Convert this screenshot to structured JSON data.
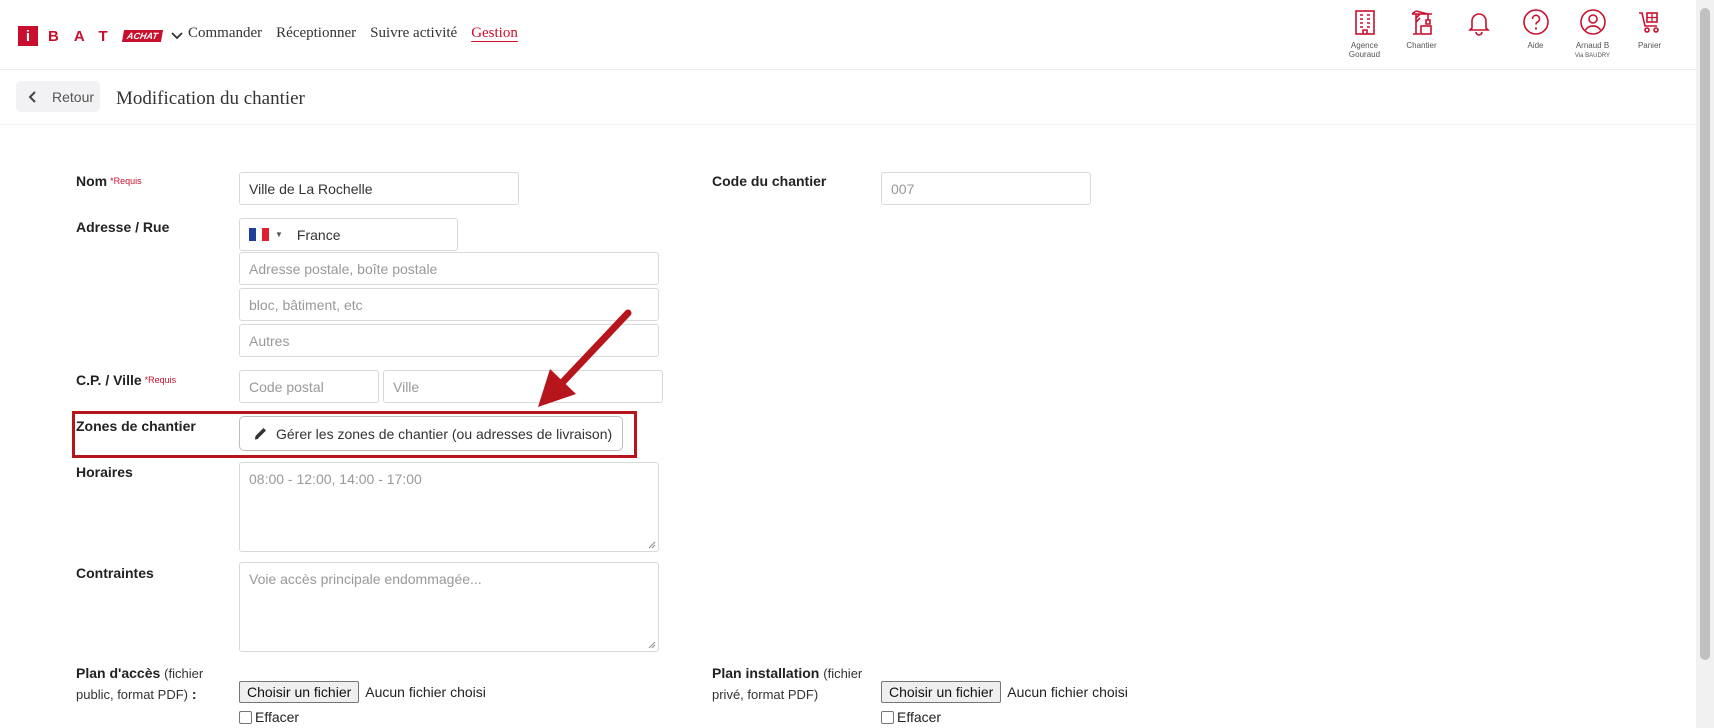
{
  "logo": {
    "initial": "i",
    "letters": "BAT",
    "badge": "ACHAT"
  },
  "nav": {
    "items": [
      {
        "label": "Commander"
      },
      {
        "label": "Réceptionner"
      },
      {
        "label": "Suivre activité"
      },
      {
        "label": "Gestion"
      }
    ],
    "active": "Gestion"
  },
  "top_icons": {
    "agency": "Agence Gouraud",
    "site": "Chantier",
    "notifications": "",
    "help": "Aide",
    "user": "Arnaud B",
    "user_sub": "Via BAUDRY",
    "cart": "Panier"
  },
  "subheader": {
    "back_label": "Retour",
    "title": "Modification du chantier"
  },
  "form": {
    "required_tag": "*Requis",
    "name": {
      "label": "Nom",
      "value": "Ville de La Rochelle"
    },
    "site_code": {
      "label": "Code du chantier",
      "placeholder": "007"
    },
    "address": {
      "label": "Adresse / Rue",
      "country": "France",
      "street_placeholder": "Adresse postale, boîte postale",
      "building_placeholder": "bloc, bâtiment, etc",
      "other_placeholder": "Autres"
    },
    "postal": {
      "label": "C.P. / Ville",
      "code_placeholder": "Code postal",
      "city_placeholder": "Ville"
    },
    "zones": {
      "label": "Zones de chantier",
      "button": "Gérer les zones de chantier (ou adresses de livraison)"
    },
    "hours": {
      "label": "Horaires",
      "placeholder": "08:00 - 12:00, 14:00 - 17:00"
    },
    "constraints": {
      "label": "Contraintes",
      "placeholder": "Voie accès principale endommagée..."
    },
    "access_plan": {
      "label": "Plan d'accès",
      "note_a": "(fichier",
      "note_b": "public, format PDF)",
      "colon": ":",
      "button": "Choisir un fichier",
      "status": "Aucun fichier choisi",
      "clear": "Effacer"
    },
    "install_plan": {
      "label": "Plan installation",
      "note_a": "(fichier",
      "note_b": "privé, format PDF)",
      "button": "Choisir un fichier",
      "status": "Aucun fichier choisi",
      "clear": "Effacer"
    }
  },
  "colors": {
    "brand": "#c8102e",
    "highlight_box": "#b5151b",
    "arrow": "#b5151b"
  }
}
